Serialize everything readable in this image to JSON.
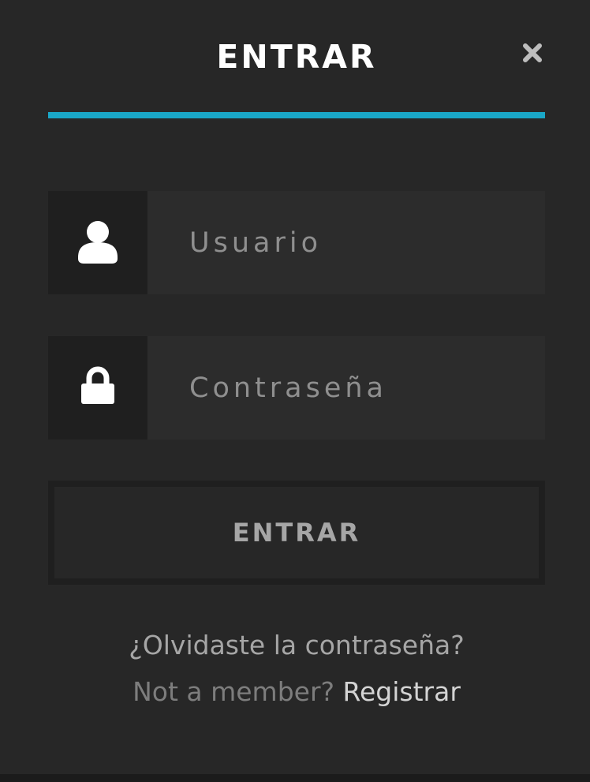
{
  "modal": {
    "title": "ENTRAR",
    "close_icon": "close-icon",
    "accent_color": "#1aa7c7"
  },
  "form": {
    "username": {
      "icon": "user-icon",
      "placeholder": "Usuario",
      "value": ""
    },
    "password": {
      "icon": "lock-icon",
      "placeholder": "Contraseña",
      "value": ""
    },
    "submit_label": "ENTRAR"
  },
  "links": {
    "forgot_password": "¿Olvidaste la contraseña?",
    "not_member_prompt": "Not a member?",
    "register": "Registrar"
  }
}
